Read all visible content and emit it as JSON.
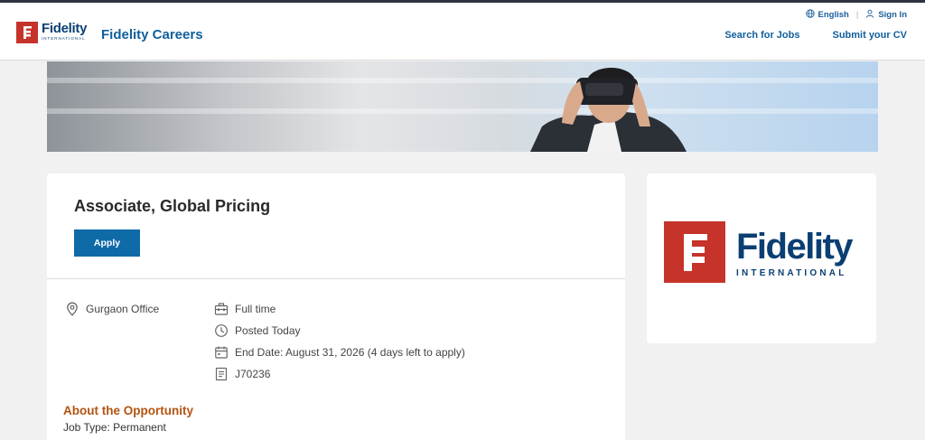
{
  "header": {
    "logo_word": "Fidelity",
    "logo_sub": "INTERNATIONAL",
    "site_title": "Fidelity Careers",
    "language": "English",
    "sign_in": "Sign In",
    "nav": [
      "Search for Jobs",
      "Submit your CV"
    ]
  },
  "job": {
    "title": "Associate, Global Pricing",
    "apply_label": "Apply",
    "location": "Gurgaon Office",
    "employment_type": "Full time",
    "posted": "Posted Today",
    "end_date": "End Date: August 31, 2026 (4 days left to apply)",
    "job_id": "J70236",
    "section_heading": "About the Opportunity",
    "job_type": "Job Type: Permanent"
  },
  "side_logo": {
    "word": "Fidelity",
    "sub": "INTERNATIONAL"
  },
  "colors": {
    "brand_red": "#c5332a",
    "brand_navy": "#0b3f73",
    "link_blue": "#0f5f9c",
    "apply_blue": "#0f6aa8",
    "section_orange": "#b3530f"
  },
  "icons": {
    "language": "globe-icon",
    "sign_in": "user-icon",
    "location": "location-pin-icon",
    "employment_type": "briefcase-icon",
    "posted": "clock-icon",
    "end_date": "calendar-icon",
    "job_id": "document-icon"
  }
}
